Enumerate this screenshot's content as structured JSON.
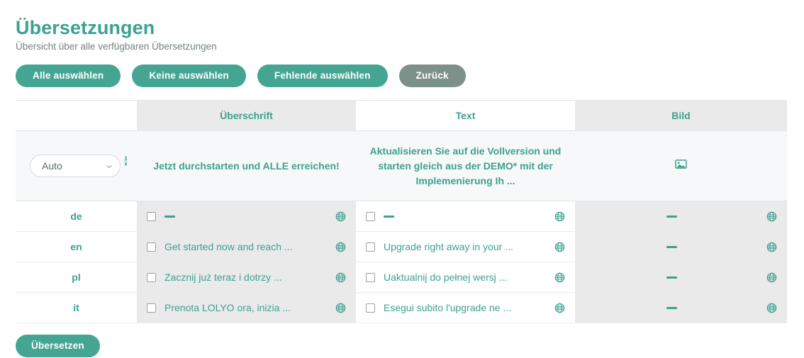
{
  "header": {
    "title": "Übersetzungen",
    "subtitle": "Übersicht über alle verfügbaren Übersetzungen"
  },
  "toolbar": {
    "select_all_label": "Alle auswählen",
    "select_none_label": "Keine auswählen",
    "select_missing_label": "Fehlende auswählen",
    "back_label": "Zurück"
  },
  "colors": {
    "accent": "#3da18f",
    "button": "#44a593",
    "muted_button": "#7d908a",
    "shaded_cell": "#eaeaea",
    "source_row": "#f6f8f9"
  },
  "table": {
    "columns": [
      {
        "key": "lang",
        "label": ""
      },
      {
        "key": "heading",
        "label": "Überschrift"
      },
      {
        "key": "text",
        "label": "Text"
      },
      {
        "key": "image",
        "label": "Bild"
      }
    ],
    "source_row": {
      "language_select": {
        "value": "Auto",
        "options": [
          "Auto"
        ]
      },
      "info_badge": "i",
      "heading": "Jetzt durchstarten und ALLE erreichen!",
      "text": "Aktualisieren Sie auf die Vollversion und starten gleich aus der DEMO* mit der Implemenierung Ih ...",
      "image_icon": "image-icon"
    },
    "rows": [
      {
        "language": "de",
        "heading": {
          "checkbox_checked": false,
          "value": "—",
          "is_empty": true,
          "globe_icon": "globe-icon"
        },
        "text": {
          "checkbox_checked": false,
          "value": "—",
          "is_empty": true,
          "globe_icon": "globe-icon"
        },
        "image": {
          "value": "—",
          "is_empty": true,
          "globe_icon": "globe-icon"
        }
      },
      {
        "language": "en",
        "heading": {
          "checkbox_checked": false,
          "value": "Get started now and reach ...",
          "is_empty": false,
          "globe_icon": "globe-icon"
        },
        "text": {
          "checkbox_checked": false,
          "value": "Upgrade right away in your ...",
          "is_empty": false,
          "globe_icon": "globe-icon"
        },
        "image": {
          "value": "—",
          "is_empty": true,
          "globe_icon": "globe-icon"
        }
      },
      {
        "language": "pl",
        "heading": {
          "checkbox_checked": false,
          "value": "Zacznij już teraz i dotrzy ...",
          "is_empty": false,
          "globe_icon": "globe-icon"
        },
        "text": {
          "checkbox_checked": false,
          "value": "Uaktualnij do pełnej wersj ...",
          "is_empty": false,
          "globe_icon": "globe-icon"
        },
        "image": {
          "value": "—",
          "is_empty": true,
          "globe_icon": "globe-icon"
        }
      },
      {
        "language": "it",
        "heading": {
          "checkbox_checked": false,
          "value": "Prenota LOLYO ora, inizia ...",
          "is_empty": false,
          "globe_icon": "globe-icon"
        },
        "text": {
          "checkbox_checked": false,
          "value": "Esegui subito l'upgrade ne ...",
          "is_empty": false,
          "globe_icon": "globe-icon"
        },
        "image": {
          "value": "—",
          "is_empty": true,
          "globe_icon": "globe-icon"
        }
      }
    ]
  },
  "footer": {
    "translate_label": "Übersetzen"
  }
}
